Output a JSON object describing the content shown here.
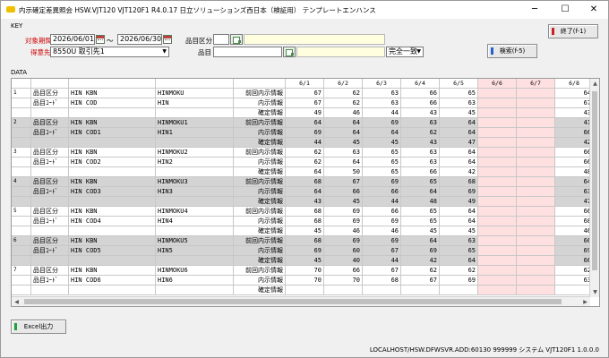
{
  "window": {
    "title": "内示確定差異照会 HSW.VJT120 VJT120F1 R4.0.17 日立ソリューションズ西日本（検証用） テンプレートエンハンス"
  },
  "key": {
    "section_label": "KEY",
    "period_label": "対象期間",
    "date_from": "2026/06/01",
    "tilde": "～",
    "date_to": "2026/06/30",
    "dest_label": "得意先",
    "dest_value": "8550U 取引先1",
    "cat_label": "品目区分",
    "item_label": "品目",
    "match_value": "完全一致"
  },
  "buttons": {
    "exit": "終了(f-1)",
    "search": "検索(f-5)",
    "excel": "Excel出力"
  },
  "data_label": "DATA",
  "grid": {
    "date_headers": [
      "6/1",
      "6/2",
      "6/3",
      "6/4",
      "6/5",
      "6/6",
      "6/7",
      "6/8"
    ],
    "pink_cols": [
      5,
      6
    ],
    "row_labels": [
      "前回内示情報",
      "内示情報",
      "確定情報"
    ],
    "cat_label": "品目区分",
    "code_label": "品目ｺｰﾄﾞ",
    "groups": [
      {
        "no": "1",
        "kbn": "HIN KBN",
        "cod": "HIN COD",
        "hinmoku": "HINMOKU",
        "hin": "HIN",
        "vals": [
          [
            "67",
            "62",
            "63",
            "66",
            "65",
            "",
            "",
            "64"
          ],
          [
            "67",
            "62",
            "63",
            "66",
            "63",
            "",
            "",
            "67"
          ],
          [
            "49",
            "46",
            "44",
            "43",
            "45",
            "",
            "",
            "43"
          ]
        ]
      },
      {
        "no": "2",
        "kbn": "HIN KBN",
        "cod": "HIN COD1",
        "hinmoku": "HINMOKU1",
        "hin": "HIN1",
        "vals": [
          [
            "64",
            "64",
            "69",
            "63",
            "64",
            "",
            "",
            "41"
          ],
          [
            "69",
            "64",
            "64",
            "62",
            "64",
            "",
            "",
            "66"
          ],
          [
            "44",
            "45",
            "45",
            "43",
            "47",
            "",
            "",
            "42"
          ]
        ]
      },
      {
        "no": "3",
        "kbn": "HIN KBN",
        "cod": "HIN COD2",
        "hinmoku": "HINMOKU2",
        "hin": "HIN2",
        "vals": [
          [
            "62",
            "63",
            "65",
            "63",
            "64",
            "",
            "",
            "66"
          ],
          [
            "62",
            "64",
            "65",
            "63",
            "64",
            "",
            "",
            "66"
          ],
          [
            "64",
            "50",
            "65",
            "66",
            "42",
            "",
            "",
            "48"
          ]
        ]
      },
      {
        "no": "4",
        "kbn": "HIN KBN",
        "cod": "HIN COD3",
        "hinmoku": "HINMOKU3",
        "hin": "HIN3",
        "vals": [
          [
            "68",
            "67",
            "69",
            "65",
            "68",
            "",
            "",
            "64"
          ],
          [
            "64",
            "66",
            "66",
            "64",
            "69",
            "",
            "",
            "63"
          ],
          [
            "43",
            "45",
            "44",
            "48",
            "49",
            "",
            "",
            "47"
          ]
        ]
      },
      {
        "no": "5",
        "kbn": "HIN KBN",
        "cod": "HIN COD4",
        "hinmoku": "HINMOKU4",
        "hin": "HIN4",
        "vals": [
          [
            "68",
            "69",
            "66",
            "65",
            "64",
            "",
            "",
            "66"
          ],
          [
            "68",
            "69",
            "69",
            "65",
            "64",
            "",
            "",
            "68"
          ],
          [
            "45",
            "46",
            "46",
            "45",
            "45",
            "",
            "",
            "46"
          ]
        ]
      },
      {
        "no": "6",
        "kbn": "HIN KBN",
        "cod": "HIN COD5",
        "hinmoku": "HINMOKU5",
        "hin": "HIN5",
        "vals": [
          [
            "68",
            "69",
            "69",
            "64",
            "63",
            "",
            "",
            "66"
          ],
          [
            "69",
            "60",
            "67",
            "69",
            "65",
            "",
            "",
            "69"
          ],
          [
            "45",
            "40",
            "44",
            "42",
            "64",
            "",
            "",
            "66"
          ]
        ]
      },
      {
        "no": "7",
        "kbn": "HIN KBN",
        "cod": "HIN COD6",
        "hinmoku": "HINMOKU6",
        "hin": "HIN6",
        "vals": [
          [
            "70",
            "66",
            "67",
            "62",
            "62",
            "",
            "",
            "62"
          ],
          [
            "70",
            "70",
            "68",
            "67",
            "69",
            "",
            "",
            "63"
          ],
          [
            "",
            "",
            "",
            "",
            "",
            "",
            "",
            ""
          ]
        ]
      }
    ]
  },
  "status": {
    "text": "LOCALHOST/HSW.DFWSVR.ADD:60130 999999 システム VJT120F1 1.0.0.0"
  },
  "colors": {
    "pink": "#ffe0e0",
    "red_label": "#d00000",
    "accent_red": "#d02020",
    "accent_green": "#20a040"
  },
  "icons": {
    "calendar": "calendar-icon",
    "lookup": "lookup-icon",
    "minimize": "─",
    "maximize": "☐",
    "close": "✕",
    "up": "▲",
    "down": "▼",
    "left": "◀",
    "right": "▶",
    "dropdown": "▼"
  }
}
